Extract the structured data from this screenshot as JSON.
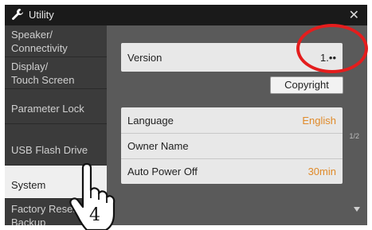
{
  "titlebar": {
    "title": "Utility",
    "close_icon": "close-icon"
  },
  "sidebar": {
    "items": [
      {
        "label": "Speaker/\nConnectivity"
      },
      {
        "label": "Display/\nTouch Screen"
      },
      {
        "label": "Parameter Lock"
      },
      {
        "label": "USB Flash Drive"
      },
      {
        "label": "System"
      },
      {
        "label": "Factory Reset/\nBackup"
      }
    ]
  },
  "main": {
    "version": {
      "label": "Version",
      "value": "1.••"
    },
    "copyright_label": "Copyright",
    "rows": [
      {
        "label": "Language",
        "value": "English"
      },
      {
        "label": "Owner Name",
        "value": ""
      },
      {
        "label": "Auto Power Off",
        "value": "30min"
      }
    ],
    "page_indicator": "1/2"
  },
  "annotation": {
    "step_number": "4"
  },
  "colors": {
    "accent": "#e08a2a",
    "highlight": "#e41d1d"
  }
}
